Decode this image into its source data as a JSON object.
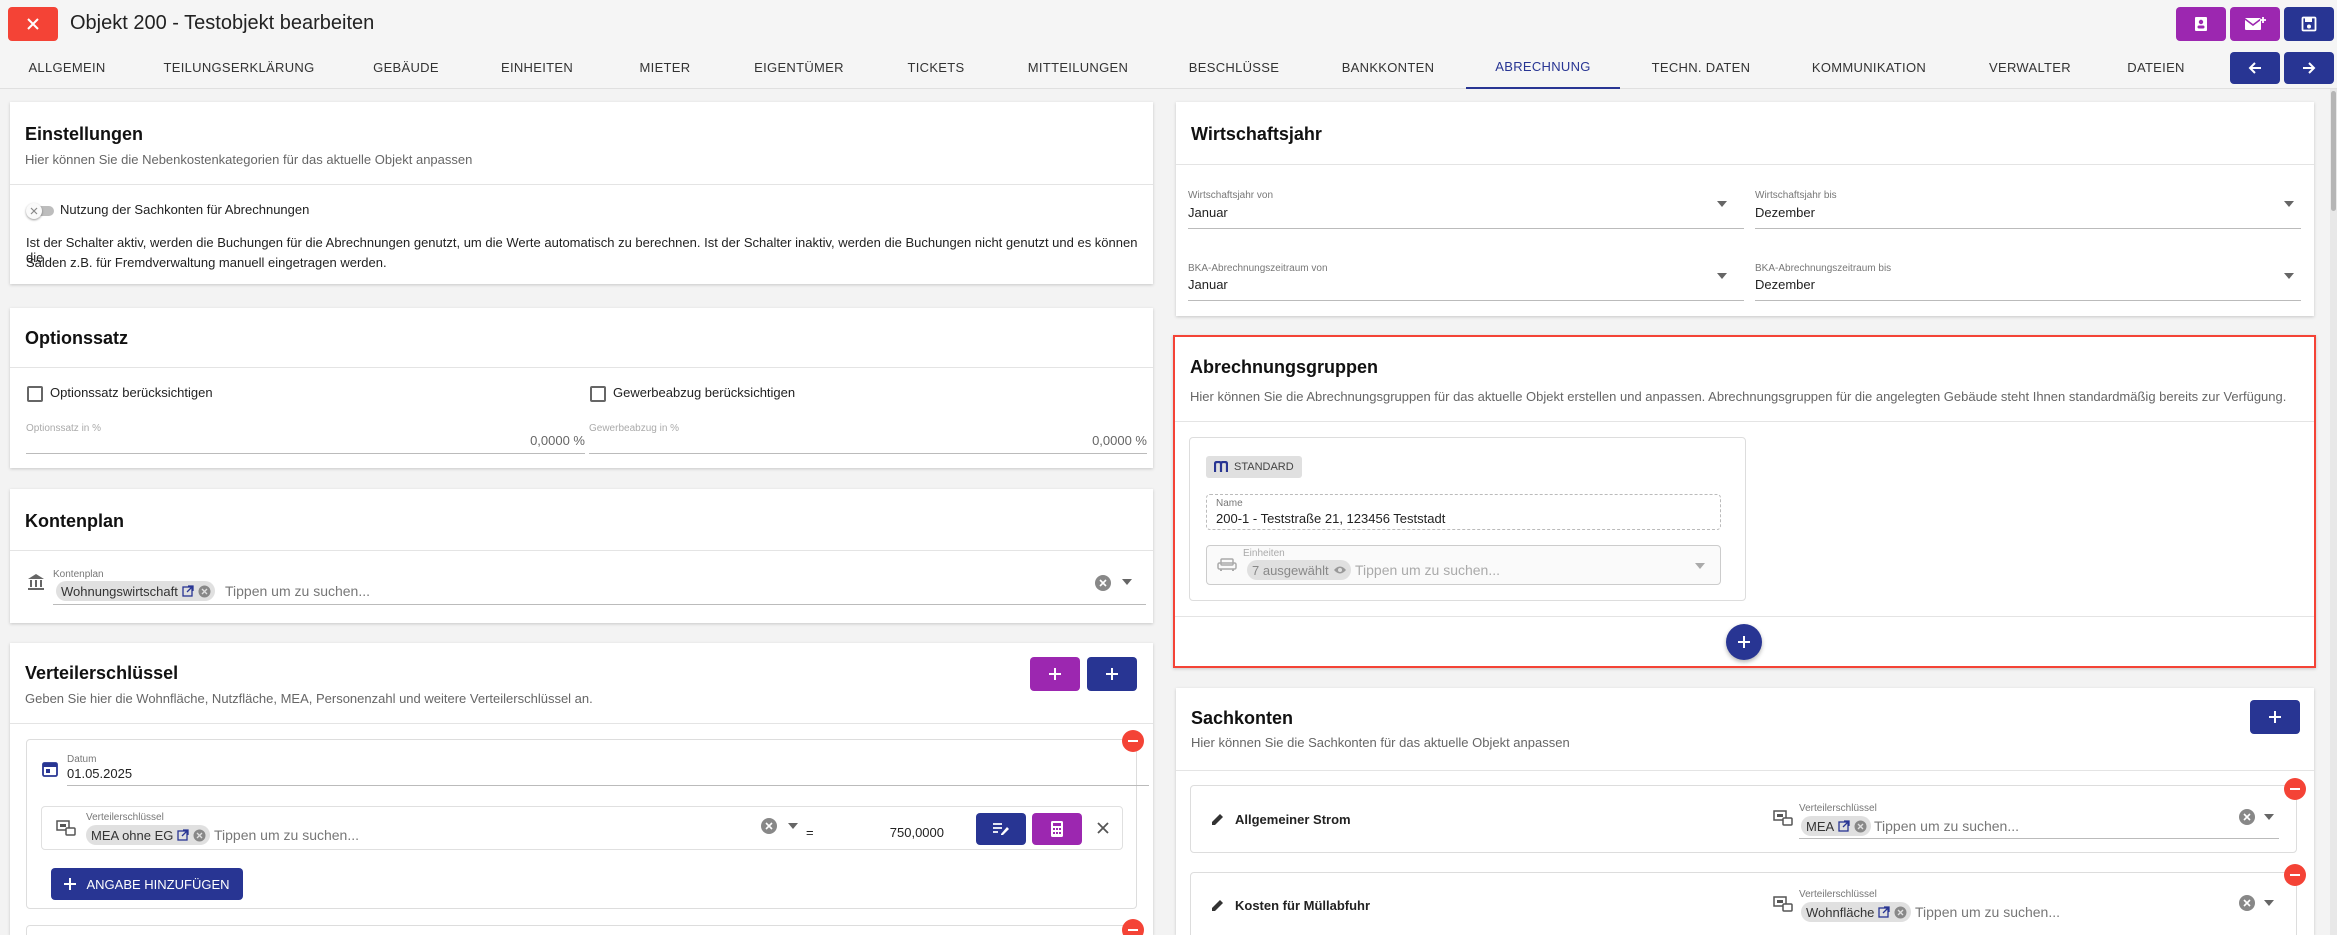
{
  "header": {
    "title": "Objekt 200 - Testobjekt bearbeiten"
  },
  "tabs": [
    {
      "label": "ALLGEMEIN"
    },
    {
      "label": "TEILUNGSERKLÄRUNG"
    },
    {
      "label": "GEBÄUDE"
    },
    {
      "label": "EINHEITEN"
    },
    {
      "label": "MIETER"
    },
    {
      "label": "EIGENTÜMER"
    },
    {
      "label": "TICKETS"
    },
    {
      "label": "MITTEILUNGEN"
    },
    {
      "label": "BESCHLÜSSE"
    },
    {
      "label": "BANKKONTEN"
    },
    {
      "label": "ABRECHNUNG"
    },
    {
      "label": "TECHN. DATEN"
    },
    {
      "label": "KOMMUNIKATION"
    },
    {
      "label": "VERWALTER"
    },
    {
      "label": "DATEIEN"
    }
  ],
  "einstellungen": {
    "title": "Einstellungen",
    "subtitle": "Hier können Sie die Nebenkostenkategorien für das aktuelle Objekt anpassen",
    "toggle_label": "Nutzung der Sachkonten für Abrechnungen",
    "desc_line1": "Ist der Schalter aktiv, werden die Buchungen für die Abrechnungen genutzt, um die Werte automatisch zu berechnen. Ist der Schalter inaktiv, werden die Buchungen nicht genutzt und es können die",
    "desc_line2": "Salden z.B. für Fremdverwaltung manuell eingetragen werden."
  },
  "optionssatz": {
    "title": "Optionssatz",
    "cb1_label": "Optionssatz berücksichtigen",
    "cb2_label": "Gewerbeabzug berücksichtigen",
    "field1_label": "Optionssatz in %",
    "field1_value": "0,0000 %",
    "field2_label": "Gewerbeabzug in %",
    "field2_value": "0,0000 %"
  },
  "kontenplan": {
    "title": "Kontenplan",
    "field_label": "Kontenplan",
    "chip": "Wohnungswirtschaft",
    "placeholder": "Tippen um zu suchen..."
  },
  "verteiler": {
    "title": "Verteilerschlüssel",
    "subtitle": "Geben Sie hier die Wohnfläche, Nutzfläche, MEA, Personenzahl und weitere Verteilerschlüssel an.",
    "datum_label": "Datum",
    "datum_value": "01.05.2025",
    "vs_label": "Verteilerschlüssel",
    "vs_chip": "MEA ohne EG",
    "vs_placeholder": "Tippen um zu suchen...",
    "equals": "=",
    "vs_value": "750,0000",
    "add_label": "ANGABE HINZUFÜGEN"
  },
  "wirtschaftsjahr": {
    "title": "Wirtschaftsjahr",
    "von_label": "Wirtschaftsjahr von",
    "von_value": "Januar",
    "bis_label": "Wirtschaftsjahr bis",
    "bis_value": "Dezember",
    "bka_von_label": "BKA-Abrechnungszeitraum von",
    "bka_von_value": "Januar",
    "bka_bis_label": "BKA-Abrechnungszeitraum bis",
    "bka_bis_value": "Dezember"
  },
  "abrechnungsgruppen": {
    "title": "Abrechnungsgruppen",
    "subtitle": "Hier können Sie die Abrechnungsgruppen für das aktuelle Objekt erstellen und anpassen. Abrechnungsgruppen für die angelegten Gebäude steht Ihnen standardmäßig bereits zur Verfügung.",
    "badge": "STANDARD",
    "name_label": "Name",
    "name_value": "200-1 - Teststraße 21, 123456 Teststadt",
    "einheiten_label": "Einheiten",
    "einheiten_chip": "7 ausgewählt",
    "einheiten_placeholder": "Tippen um zu suchen..."
  },
  "sachkonten": {
    "title": "Sachkonten",
    "subtitle": "Hier können Sie die Sachkonten für das aktuelle Objekt anpassen",
    "items": [
      {
        "name": "Allgemeiner Strom",
        "vs_label": "Verteilerschlüssel",
        "chip": "MEA",
        "placeholder": "Tippen um zu suchen..."
      },
      {
        "name": "Kosten für Müllabfuhr",
        "vs_label": "Verteilerschlüssel",
        "chip": "Wohnfläche",
        "placeholder": "Tippen um zu suchen..."
      }
    ]
  },
  "colors": {
    "primary": "#283593",
    "accent": "#9c27b0",
    "danger": "#f44336"
  }
}
